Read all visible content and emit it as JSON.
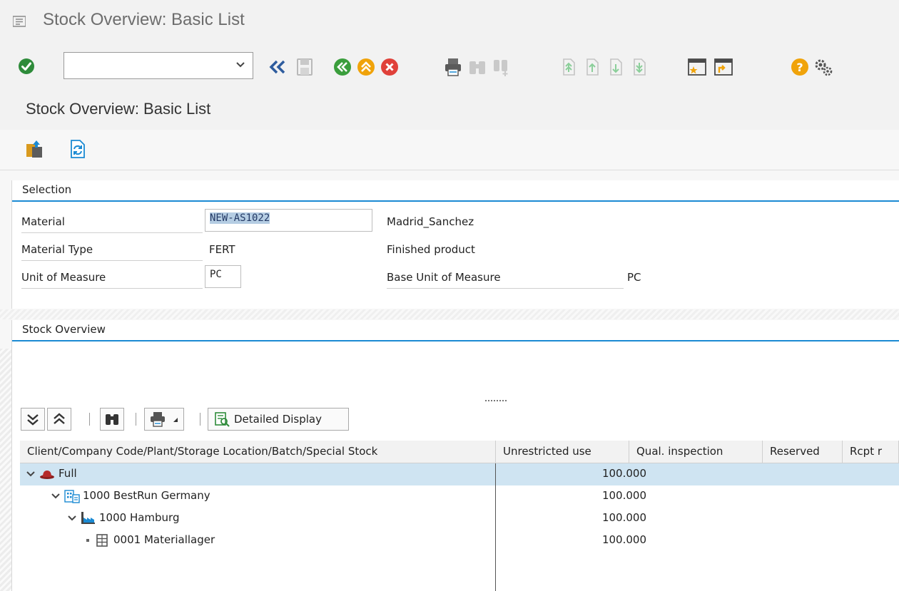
{
  "window": {
    "title": "Stock Overview: Basic List",
    "command_field_value": ""
  },
  "screen": {
    "title": "Stock Overview: Basic List"
  },
  "selection": {
    "group_title": "Selection",
    "material_label": "Material",
    "material_value": "NEW-AS1022",
    "material_desc": "Madrid_Sanchez",
    "material_type_label": "Material Type",
    "material_type_value": "FERT",
    "material_type_desc": "Finished product",
    "uom_label": "Unit of Measure",
    "uom_value": "PC",
    "base_uom_label": "Base Unit of Measure",
    "base_uom_value": "PC"
  },
  "overview": {
    "group_title": "Stock Overview",
    "detailed_display_label": "Detailed Display",
    "columns": [
      "Client/Company Code/Plant/Storage Location/Batch/Special Stock",
      "Unrestricted use",
      "Qual. inspection",
      "Reserved",
      "Rcpt r"
    ],
    "rows": [
      {
        "name": "Full",
        "unrestricted": "100.000",
        "level": 0,
        "icon": "hat-icon"
      },
      {
        "name": "1000 BestRun Germany",
        "unrestricted": "100.000",
        "level": 1,
        "icon": "company-icon"
      },
      {
        "name": "1000 Hamburg",
        "unrestricted": "100.000",
        "level": 2,
        "icon": "factory-icon"
      },
      {
        "name": "0001 Materiallager",
        "unrestricted": "100.000",
        "level": 3,
        "icon": "storage-icon"
      }
    ]
  },
  "colors": {
    "accent_blue": "#1b8ad3",
    "selected_row": "#cfe4f2",
    "ok_green": "#2e8b3a",
    "nav_green": "#3a9e3c",
    "nav_orange": "#f0a30a",
    "cancel_red": "#e0413a"
  }
}
